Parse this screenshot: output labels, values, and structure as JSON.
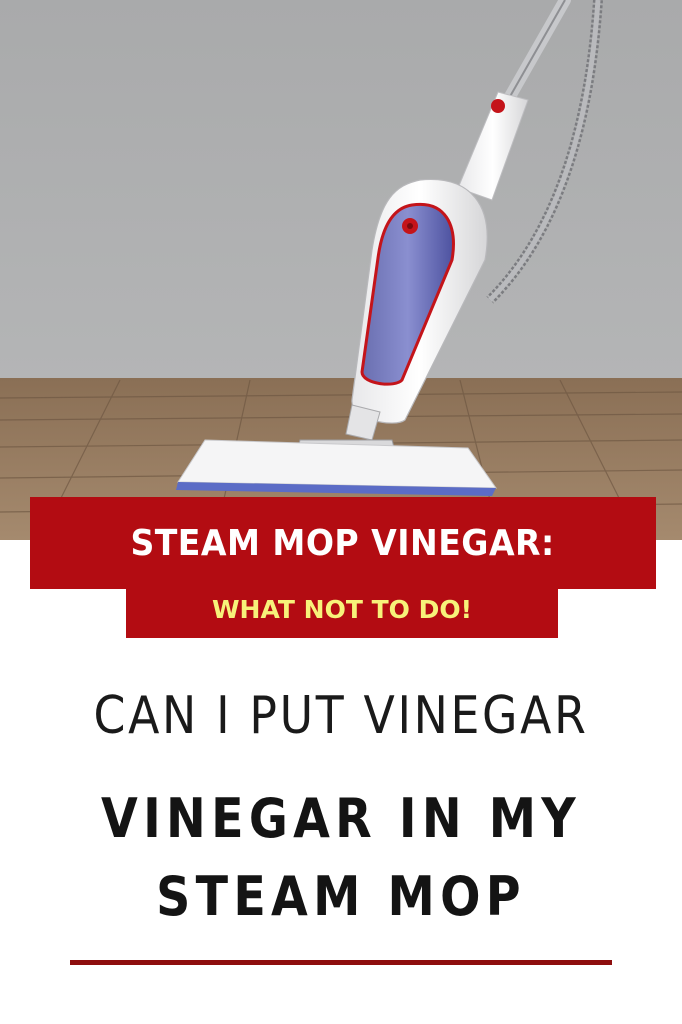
{
  "banner": {
    "title": "STEAM MOP VINEGAR:",
    "subtitle": "WHAT NOT TO DO!"
  },
  "question": "CAN I PUT VINEGAR",
  "headline": {
    "line1": "VINEGAR IN MY",
    "line2": "STEAM MOP"
  },
  "colors": {
    "banner_red": "#b30c12",
    "subtitle_yellow": "#f7f27a",
    "rule_red": "#8e0e0e",
    "text_dark": "#141414"
  }
}
